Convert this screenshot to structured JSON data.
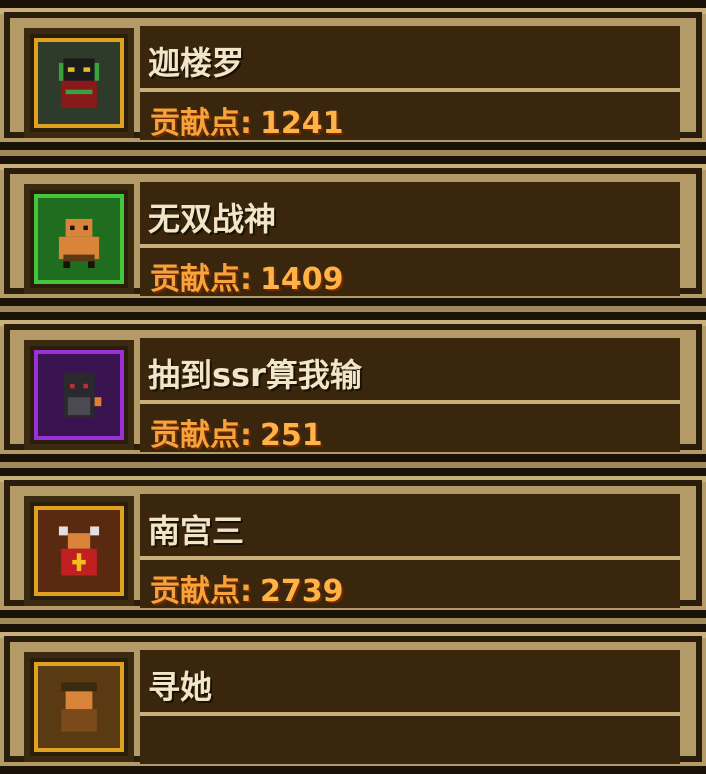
{
  "members": [
    {
      "name": "迦楼罗",
      "stat_label": "贡献点:",
      "stat_value": "1241",
      "avatar_icon": "masked-warrior-avatar-icon",
      "frame_color": "#e0a020",
      "avatar_bg": "#2e3b2a"
    },
    {
      "name": "无双战神",
      "stat_label": "贡献点:",
      "stat_value": "1409",
      "avatar_icon": "berserker-avatar-icon",
      "frame_color": "#43c63a",
      "avatar_bg": "#1f6e1f"
    },
    {
      "name": "抽到ssr算我输",
      "stat_label": "贡献点:",
      "stat_value": "251",
      "avatar_icon": "hooded-assassin-avatar-icon",
      "frame_color": "#9a30d6",
      "avatar_bg": "#3a1450"
    },
    {
      "name": "南宫三",
      "stat_label": "贡献点:",
      "stat_value": "2739",
      "avatar_icon": "priest-avatar-icon",
      "frame_color": "#e0a020",
      "avatar_bg": "#5a2a10"
    },
    {
      "name": "寻她",
      "stat_label": "",
      "stat_value": "",
      "avatar_icon": "rogue-avatar-icon",
      "frame_color": "#e0a020",
      "avatar_bg": "#5a3a12"
    }
  ]
}
